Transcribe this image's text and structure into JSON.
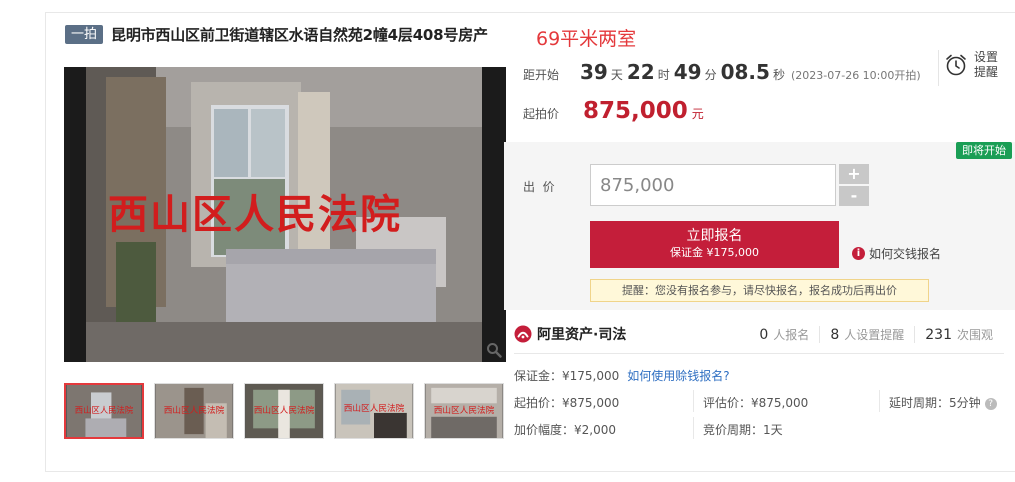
{
  "title": {
    "tag": "一拍",
    "text": "昆明市西山区前卫街道辖区水语自然苑2幢4层408号房产",
    "note": "69平米两室"
  },
  "gallery": {
    "watermark": "西山区人民法院",
    "thumbnail_count": 5,
    "active_index": 0
  },
  "countdown": {
    "label": "距开始",
    "days": "39",
    "days_unit": "天",
    "hours": "22",
    "hours_unit": "时",
    "minutes": "49",
    "minutes_unit": "分",
    "seconds": "08.5",
    "seconds_unit": "秒",
    "start_time": "(2023-07-26 10:00开拍)"
  },
  "remind": {
    "label": "设置提醒"
  },
  "start_price": {
    "label": "起拍价",
    "value": "875,000",
    "unit": "元"
  },
  "bid": {
    "badge": "即将开始",
    "label": "出  价",
    "value": "875,000",
    "plus": "+",
    "minus": "-",
    "signup_label": "立即报名",
    "deposit_text": "保证金 ¥175,000",
    "howto": "如何交钱报名",
    "notice": "提醒：您没有报名参与，请尽快报名，报名成功后再出价"
  },
  "brand": {
    "name": "阿里资产·司法",
    "stats": [
      {
        "num": "0",
        "text": "人报名"
      },
      {
        "num": "8",
        "text": "人设置提醒"
      },
      {
        "num": "231",
        "text": "次围观"
      }
    ]
  },
  "details": {
    "deposit": "保证金：¥175,000",
    "deposit_link": "如何使用赊钱报名?",
    "start_price": "起拍价：¥875,000",
    "appraisal": "评估价：¥875,000",
    "delay": "延时周期：5分钟",
    "increment": "加价幅度：¥2,000",
    "bid_cycle": "竞价周期：1天"
  },
  "colors": {
    "accent_red": "#c41e3a",
    "price_red": "#c0202f",
    "badge_green": "#1a9e55",
    "link_blue": "#2f6fc2"
  }
}
